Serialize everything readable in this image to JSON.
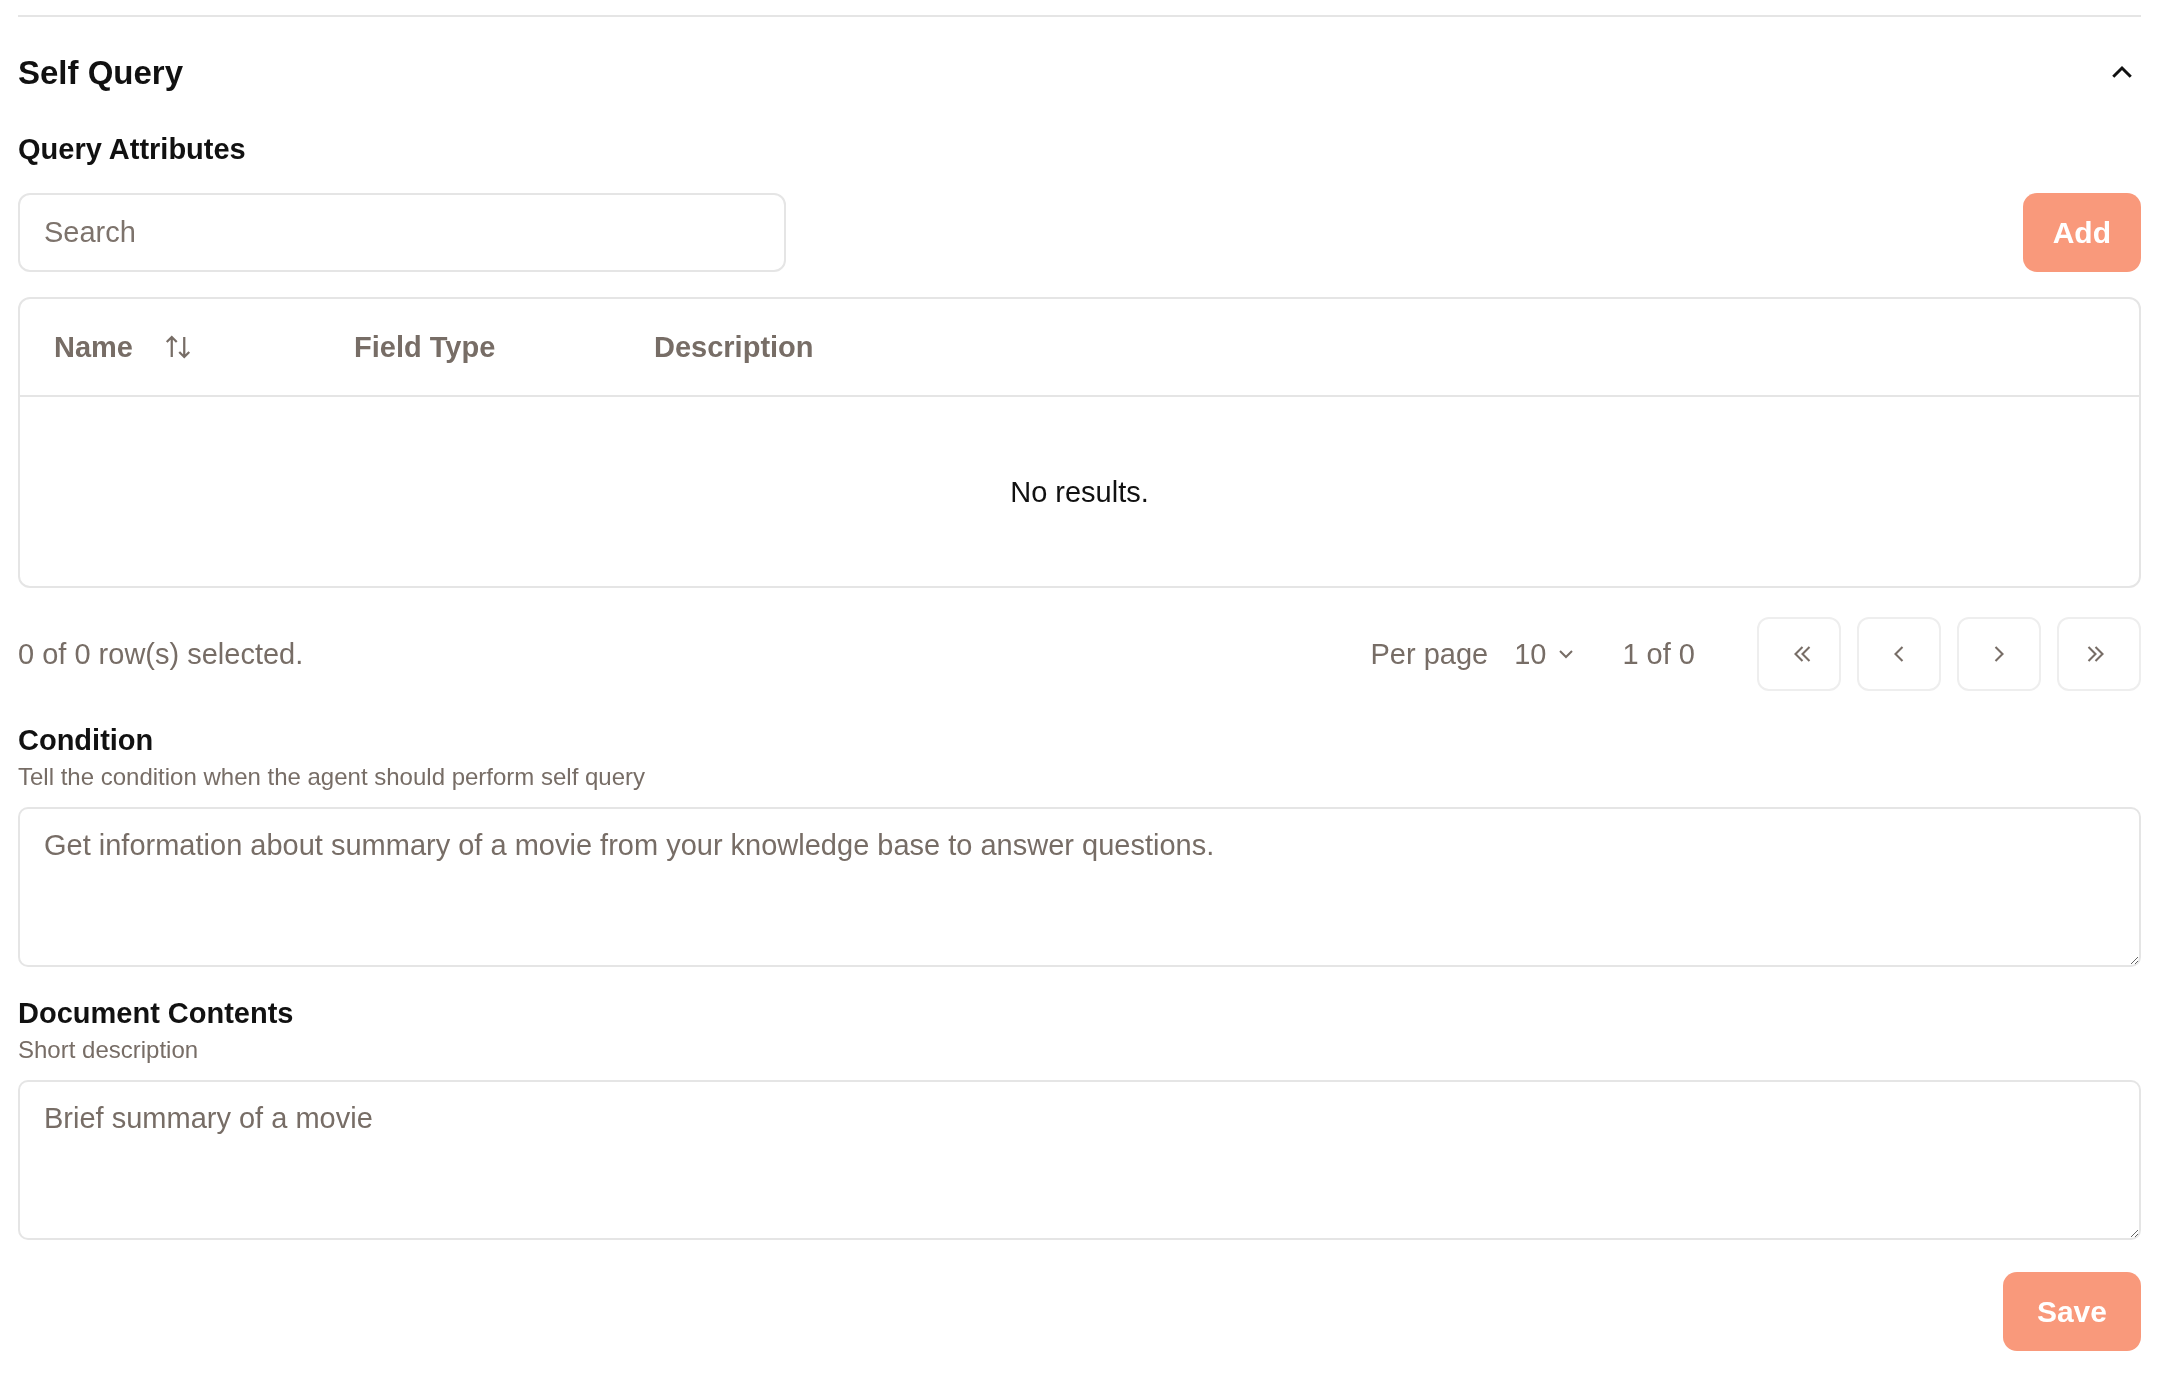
{
  "section": {
    "title": "Self Query",
    "expanded": true
  },
  "query_attributes": {
    "label": "Query Attributes",
    "search": {
      "placeholder": "Search"
    },
    "add_button": "Add"
  },
  "table": {
    "columns": [
      {
        "label": "Name",
        "sortable": true
      },
      {
        "label": "Field Type",
        "sortable": false
      },
      {
        "label": "Description",
        "sortable": false
      }
    ],
    "empty_message": "No results."
  },
  "pagination": {
    "selection_status": "0 of 0 row(s) selected.",
    "per_page_label": "Per page",
    "per_page_value": "10",
    "page_status": "1 of 0",
    "buttons": [
      {
        "kind": "first"
      },
      {
        "kind": "previous"
      },
      {
        "kind": "next"
      },
      {
        "kind": "last"
      }
    ]
  },
  "fields": [
    {
      "label": "Condition",
      "description": "Tell the condition when the agent should perform self query",
      "value": "Get information about summary of a movie from your knowledge base to answer questions."
    },
    {
      "label": "Document Contents",
      "description": "Short description",
      "value": "Brief summary of a movie"
    }
  ],
  "save_button": "Save"
}
